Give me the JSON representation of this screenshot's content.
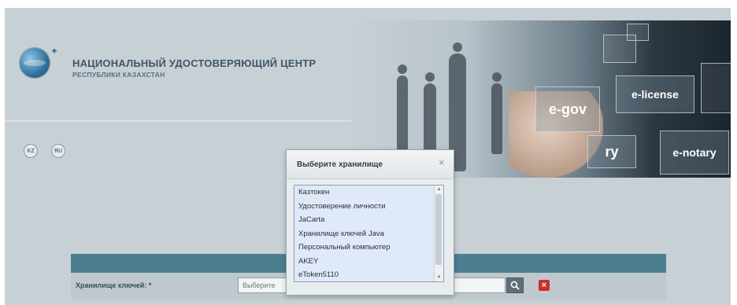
{
  "header": {
    "title": "НАЦИОНАЛЬНЫЙ УДОСТОВЕРЯЮЩИЙ ЦЕНТР",
    "subtitle": "РЕСПУБЛИКИ КАЗАХСТАН",
    "logo_icon": "globe-icon",
    "languages": [
      "KZ",
      "RU"
    ]
  },
  "banner": {
    "tiles": [
      "e-license",
      "e-gov",
      "e-notary",
      "ry"
    ]
  },
  "form": {
    "field_label": "Хранилище ключей: *",
    "field_placeholder": "Выберите",
    "search_icon": "search-icon",
    "clear_icon": "close-icon",
    "clear_color": "#c9302c",
    "bar_color": "#4b7f8f"
  },
  "dialog": {
    "title": "Выберите хранилище",
    "close_label": "×",
    "options": [
      "Казтокен",
      "Удостоверение личности",
      "JaCarta",
      "Хранилище ключей Java",
      "Персональный компьютер",
      "AKEY",
      "eToken5110"
    ]
  }
}
